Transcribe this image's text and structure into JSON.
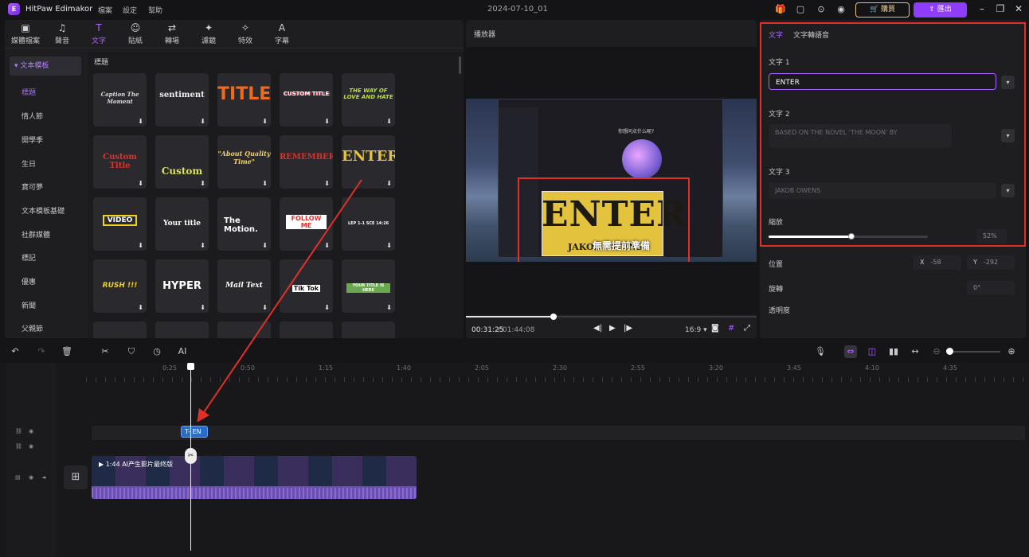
{
  "app": {
    "name": "HitPaw Edimakor",
    "logo_text": "E"
  },
  "menu": [
    "檔案",
    "設定",
    "幫助"
  ],
  "project_title": "2024-07-10_01",
  "topbar": {
    "buy_label": "購買",
    "export_label": "匯出"
  },
  "tools": [
    {
      "label": "媒體檔案",
      "icon": "media-icon"
    },
    {
      "label": "聲音",
      "icon": "music-icon"
    },
    {
      "label": "文字",
      "icon": "text-icon"
    },
    {
      "label": "貼紙",
      "icon": "sticker-icon"
    },
    {
      "label": "轉場",
      "icon": "transition-icon"
    },
    {
      "label": "濾鏡",
      "icon": "filter-icon"
    },
    {
      "label": "特效",
      "icon": "effect-icon"
    },
    {
      "label": "字幕",
      "icon": "subtitle-icon"
    }
  ],
  "categories": {
    "header": "文本模板",
    "items": [
      "標題",
      "情人節",
      "開學季",
      "生日",
      "寶可夢",
      "文本模板基礎",
      "社群媒體",
      "標記",
      "優惠",
      "新聞",
      "父親節"
    ]
  },
  "grid": {
    "title": "標題",
    "thumbs": [
      "Caption The Moment",
      "sentiment",
      "TITLE",
      "CUSTOM TITLE",
      "THE WAY OF LOVE AND HATE",
      "Custom Title",
      "Custom",
      "\"About Quality Time\"",
      "REMEMBER",
      "ENTER",
      "VIDEO",
      "Your title",
      "The Motion.",
      "FOLLOW ME",
      "LEP 1-1 SCE 14:26",
      "RUSH !!!",
      "HYPER",
      "Mail Text",
      "Tik Tok",
      "YOUR TITLE IS HERE"
    ]
  },
  "preview": {
    "title": "播放器",
    "inner_question": "你想问点什么呢?",
    "overlay_title": "ENTER",
    "overlay_sub": "JAKOB OWENS",
    "caption": "無需提前準備",
    "current_time": "00:31:25",
    "total_time": "/ 01:44:08",
    "ratio": "16:9",
    "progress": 0.3
  },
  "props": {
    "tabs": [
      "文字",
      "文字轉語音"
    ],
    "text1_label": "文字 1",
    "text1_value": "ENTER",
    "text2_label": "文字 2",
    "text2_value": "BASED ON THE NOVEL 'THE MOON' BY",
    "text3_label": "文字 3",
    "text3_value": "JAKOB OWENS",
    "scale_label": "縮放",
    "scale_value": "52%",
    "scale_fraction": 0.52,
    "position_label": "位置",
    "pos_x_tag": "X",
    "pos_x": "-58",
    "pos_y_tag": "Y",
    "pos_y": "-292",
    "rotate_label": "旋轉",
    "rotate_value": "0°",
    "opacity_label": "透明度"
  },
  "timeline": {
    "ruler": [
      "0:25",
      "0:50",
      "1:15",
      "1:40",
      "2:05",
      "2:30",
      "2:55",
      "3:20",
      "3:45",
      "4:10",
      "4:35"
    ],
    "text_clip": "T- EN",
    "video_clip": "1:44 AI产生影片最终版"
  },
  "colors": {
    "accent": "#a866ff",
    "annotation": "#e0302a",
    "export": "#8e3dfa"
  }
}
